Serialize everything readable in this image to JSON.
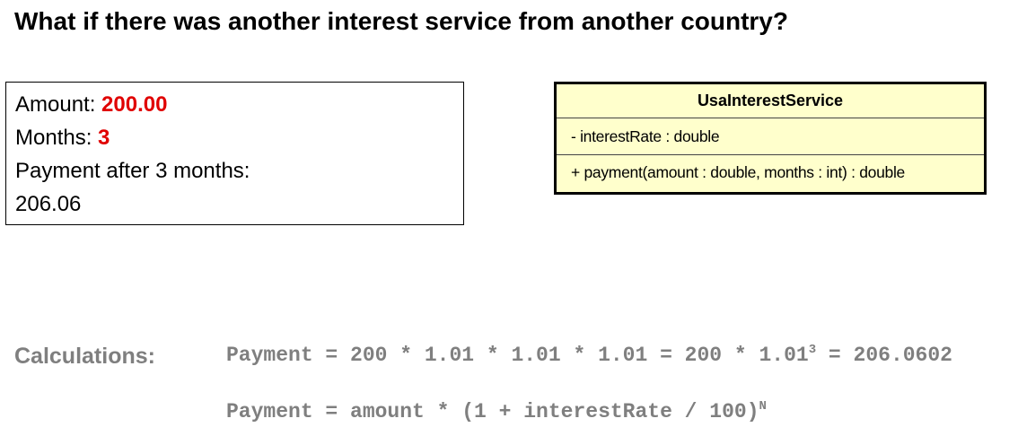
{
  "title": "What if there was another interest service from another country?",
  "info": {
    "amount_label": "Amount: ",
    "amount_value": "200.00",
    "months_label": "Months: ",
    "months_value": "3",
    "payment_label": "Payment after 3 months:",
    "payment_value": "206.06",
    "highlight_color": "#e00000"
  },
  "uml": {
    "class_name": "UsaInterestService",
    "attributes": [
      "- interestRate : double"
    ],
    "methods": [
      "+ payment(amount : double, months : int) : double"
    ],
    "fill_color": "#ffffcc"
  },
  "calculations": {
    "label": "Calculations:",
    "line1_pre": "Payment = 200 * 1.01 * 1.01 * 1.01 = 200 * 1.01",
    "line1_exp": "3",
    "line1_post": " = 206.0602",
    "line2_pre": "Payment = amount * (1 + interestRate / 100)",
    "line2_exp": "N"
  }
}
